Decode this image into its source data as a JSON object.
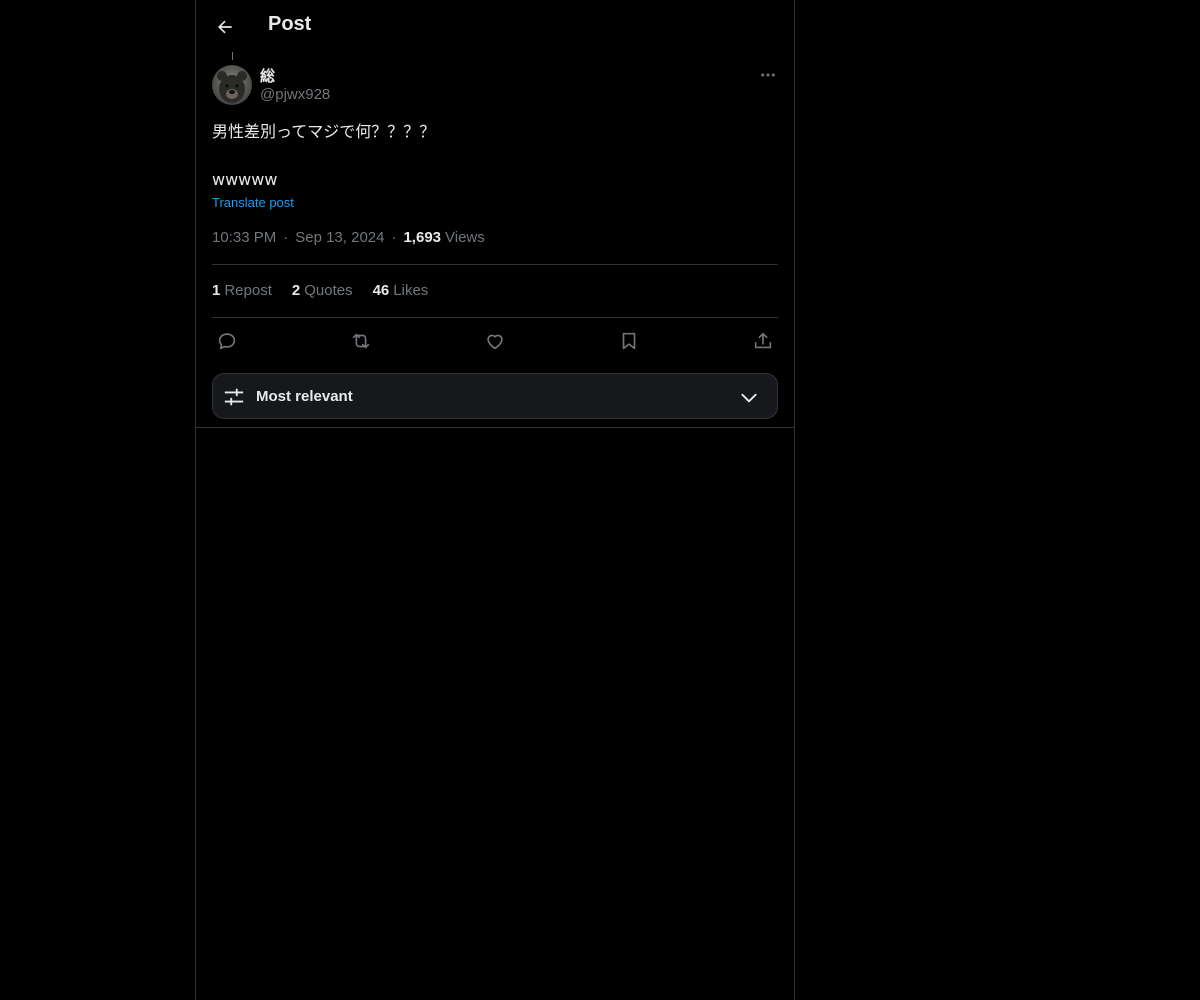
{
  "header": {
    "title": "Post"
  },
  "post": {
    "author_name": "総",
    "author_handle": "@pjwx928",
    "text": "男性差別ってマジで何？？？？\n\nwwwww",
    "translate_label": "Translate post",
    "time": "10:33 PM",
    "date": "Sep 13, 2024",
    "views_count": "1,693",
    "views_label": "Views",
    "separator": "·"
  },
  "stats": {
    "reposts_count": "1",
    "reposts_label": "Repost",
    "quotes_count": "2",
    "quotes_label": "Quotes",
    "likes_count": "46",
    "likes_label": "Likes"
  },
  "icons": {
    "back": "arrow-left-icon",
    "more": "more-horizontal-icon",
    "reply": "reply-icon",
    "repost": "repost-icon",
    "like": "heart-icon",
    "bookmark": "bookmark-icon",
    "share": "share-icon",
    "sort": "sliders-icon",
    "chevron": "chevron-down-icon"
  },
  "sort": {
    "label": "Most relevant"
  },
  "colors": {
    "background": "#000000",
    "text": "#e7e9ea",
    "muted": "#71767b",
    "link": "#1d9bf0",
    "border": "#2f3336"
  }
}
